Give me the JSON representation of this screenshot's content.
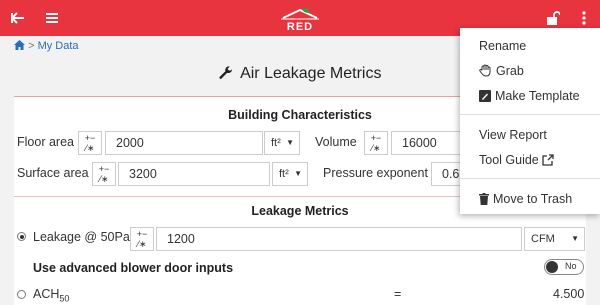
{
  "header": {
    "back_icon": "back-arrow-icon",
    "menu_icon": "hamburger-icon",
    "logo_text": "RED",
    "lock_icon": "unlock-icon",
    "more_icon": "vertical-dots-icon"
  },
  "breadcrumb": {
    "home_icon": "home-icon",
    "sep": ">",
    "item": "My Data"
  },
  "page": {
    "title": "Air Leakage Metrics",
    "title_icon": "wrench-icon"
  },
  "building": {
    "title": "Building Characteristics",
    "floor_area": {
      "label": "Floor area",
      "value": "2000",
      "unit": "ft²"
    },
    "volume": {
      "label": "Volume",
      "value": "16000"
    },
    "surface_area": {
      "label": "Surface area",
      "value": "3200",
      "unit": "ft²"
    },
    "pressure_exponent": {
      "label": "Pressure exponent",
      "value": "0.65"
    },
    "stepper_symbol_top": "+−",
    "stepper_symbol_bottom": "⁄∗",
    "caret": "▼"
  },
  "leakage": {
    "title": "Leakage Metrics",
    "leakage_50": {
      "label": "Leakage @ 50Pa",
      "value": "1200",
      "unit": "CFM",
      "selected": true
    },
    "advanced": {
      "label": "Use advanced blower door inputs",
      "toggle": "No"
    },
    "ach50": {
      "label": "ACH",
      "sub": "50",
      "equals": "=",
      "value": "4.500"
    }
  },
  "menu": {
    "rename": "Rename",
    "grab": "Grab",
    "make_template": "Make Template",
    "view_report": "View Report",
    "tool_guide": "Tool Guide",
    "move_to_trash": "Move to Trash"
  },
  "colors": {
    "header": "#e7343f",
    "link": "#2a6fb5"
  }
}
